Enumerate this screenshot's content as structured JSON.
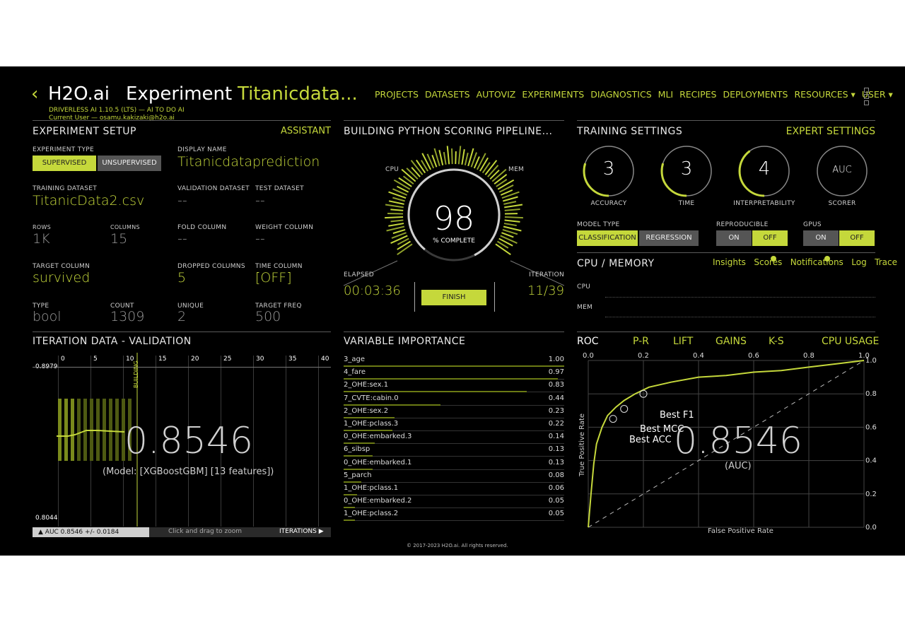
{
  "header": {
    "back_icon": "chevron-left-icon",
    "logo": "H2O.ai",
    "title_prefix": "Experiment",
    "title_name": "Titanicdata...",
    "subtitle": "DRIVERLESS AI 1.10.5 (LTS) — AI TO DO AI",
    "user_line": "Current User — osamu.kakizaki@h2o.ai",
    "nav": [
      "PROJECTS",
      "DATASETS",
      "AUTOVIZ",
      "EXPERIMENTS",
      "DIAGNOSTICS",
      "MLI",
      "RECIPES",
      "DEPLOYMENTS",
      "RESOURCES ▾",
      "USER ▾"
    ],
    "menu_icon": "vertical-dots-icon"
  },
  "setup": {
    "title": "EXPERIMENT SETUP",
    "assistant": "ASSISTANT",
    "exp_type_label": "EXPERIMENT TYPE",
    "supervised": "SUPERVISED",
    "unsupervised": "UNSUPERVISED",
    "display_name_label": "DISPLAY NAME",
    "display_name": "Titanicdataprediction",
    "training_dataset_label": "TRAINING DATASET",
    "training_dataset": "TitanicData2.csv",
    "validation_dataset_label": "VALIDATION DATASET",
    "validation_dataset": "--",
    "test_dataset_label": "TEST DATASET",
    "test_dataset": "--",
    "rows_label": "ROWS",
    "rows": "1K",
    "columns_label": "COLUMNS",
    "columns": "15",
    "fold_column_label": "FOLD COLUMN",
    "fold_column": "--",
    "weight_column_label": "WEIGHT COLUMN",
    "weight_column": "--",
    "target_column_label": "TARGET COLUMN",
    "target_column": "survived",
    "dropped_columns_label": "DROPPED COLUMNS",
    "dropped_columns": "5",
    "time_column_label": "TIME COLUMN",
    "time_column": "[OFF]",
    "type_label": "TYPE",
    "type": "bool",
    "count_label": "COUNT",
    "count": "1309",
    "unique_label": "UNIQUE",
    "unique": "2",
    "target_freq_label": "TARGET FREQ",
    "target_freq": "500"
  },
  "pipeline": {
    "title": "BUILDING PYTHON SCORING PIPELINE...",
    "cpu": "CPU",
    "mem": "MEM",
    "percent": "98",
    "percent_label": "% COMPLETE",
    "elapsed_label": "ELAPSED",
    "elapsed": "00:03:36",
    "iteration_label": "ITERATION",
    "iteration": "11/39",
    "finish": "FINISH",
    "progress_fraction": 0.98
  },
  "training": {
    "title": "TRAINING SETTINGS",
    "expert": "EXPERT SETTINGS",
    "dials": [
      {
        "value": "3",
        "label": "ACCURACY",
        "level": 0.3
      },
      {
        "value": "3",
        "label": "TIME",
        "level": 0.3
      },
      {
        "value": "4",
        "label": "INTERPRETABILITY",
        "level": 0.4
      },
      {
        "value": "AUC",
        "label": "SCORER",
        "level": 0
      }
    ],
    "model_type_label": "MODEL TYPE",
    "classification": "CLASSIFICATION",
    "regression": "REGRESSION",
    "reproducible_label": "REPRODUCIBLE",
    "gpus_label": "GPUS",
    "on": "ON",
    "off": "OFF"
  },
  "cpumem": {
    "title": "CPU / MEMORY",
    "links": [
      "Insights",
      "Scores",
      "Notifications",
      "Log",
      "Trace"
    ],
    "cpu": "CPU",
    "mem": "MEM"
  },
  "iteration": {
    "title": "ITERATION DATA - VALIDATION",
    "ticks": [
      "0",
      "5",
      "10",
      "15",
      "20",
      "25",
      "30",
      "35",
      "40"
    ],
    "ymax": "0.8979",
    "ymin": "0.8044",
    "building": "BUILDING",
    "score": "0.8546",
    "model": "(Model: [XGBoostGBM] [13 features])",
    "auc_line": "▲ AUC 0.8546 +/- 0.0184",
    "hint": "Click and drag to zoom",
    "iterations": "ITERATIONS ▶"
  },
  "varimp": {
    "title": "VARIABLE IMPORTANCE",
    "rows": [
      {
        "name": "3_age",
        "value": "1.00",
        "frac": 1.0
      },
      {
        "name": "4_fare",
        "value": "0.97",
        "frac": 0.97
      },
      {
        "name": "2_OHE:sex.1",
        "value": "0.83",
        "frac": 0.83
      },
      {
        "name": "7_CVTE:cabin.0",
        "value": "0.44",
        "frac": 0.44
      },
      {
        "name": "2_OHE:sex.2",
        "value": "0.23",
        "frac": 0.23
      },
      {
        "name": "1_OHE:pclass.3",
        "value": "0.22",
        "frac": 0.22
      },
      {
        "name": "0_OHE:embarked.3",
        "value": "0.14",
        "frac": 0.14
      },
      {
        "name": "6_sibsp",
        "value": "0.13",
        "frac": 0.13
      },
      {
        "name": "0_OHE:embarked.1",
        "value": "0.13",
        "frac": 0.13
      },
      {
        "name": "5_parch",
        "value": "0.08",
        "frac": 0.08
      },
      {
        "name": "1_OHE:pclass.1",
        "value": "0.06",
        "frac": 0.06
      },
      {
        "name": "0_OHE:embarked.2",
        "value": "0.05",
        "frac": 0.05
      },
      {
        "name": "1_OHE:pclass.2",
        "value": "0.05",
        "frac": 0.05
      }
    ]
  },
  "roc": {
    "tabs": [
      "ROC",
      "P-R",
      "LIFT",
      "GAINS",
      "K-S",
      "CPU USAGE"
    ],
    "x_ticks": [
      "0.0",
      "0.2",
      "0.4",
      "0.6",
      "0.8",
      "1.0"
    ],
    "y_ticks": [
      "1.0",
      "0.8",
      "0.6",
      "0.4",
      "0.2",
      "0.0"
    ],
    "xlabel": "False Positive Rate",
    "ylabel": "True Positive Rate",
    "auc": "0.8546",
    "auc_label": "(AUC)",
    "best_f1": "Best F1",
    "best_mcc": "Best MCC",
    "best_acc": "Best ACC"
  },
  "footer": "© 2017-2023 H2O.ai. All rights reserved.",
  "colors": {
    "accent": "#c5d83b",
    "background": "#000000"
  },
  "chart_data": [
    {
      "type": "line",
      "title": "ROC",
      "xlabel": "False Positive Rate",
      "ylabel": "True Positive Rate",
      "xlim": [
        0,
        1
      ],
      "ylim": [
        0,
        1
      ],
      "x": [
        0.0,
        0.01,
        0.02,
        0.03,
        0.05,
        0.07,
        0.1,
        0.13,
        0.17,
        0.22,
        0.3,
        0.4,
        0.5,
        0.6,
        0.7,
        0.8,
        0.9,
        1.0
      ],
      "y": [
        0.0,
        0.2,
        0.38,
        0.5,
        0.6,
        0.67,
        0.72,
        0.76,
        0.8,
        0.84,
        0.87,
        0.9,
        0.91,
        0.93,
        0.94,
        0.96,
        0.98,
        1.0
      ],
      "annotations": [
        "Best F1",
        "Best MCC",
        "Best ACC"
      ],
      "grid": true
    },
    {
      "type": "bar",
      "title": "VARIABLE IMPORTANCE",
      "categories": [
        "3_age",
        "4_fare",
        "2_OHE:sex.1",
        "7_CVTE:cabin.0",
        "2_OHE:sex.2",
        "1_OHE:pclass.3",
        "0_OHE:embarked.3",
        "6_sibsp",
        "0_OHE:embarked.1",
        "5_parch",
        "1_OHE:pclass.1",
        "0_OHE:embarked.2",
        "1_OHE:pclass.2"
      ],
      "values": [
        1.0,
        0.97,
        0.83,
        0.44,
        0.23,
        0.22,
        0.14,
        0.13,
        0.13,
        0.08,
        0.06,
        0.05,
        0.05
      ]
    }
  ]
}
